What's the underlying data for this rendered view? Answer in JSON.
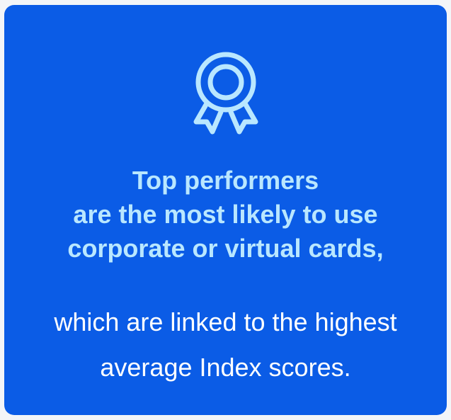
{
  "card": {
    "icon": "award-ribbon-icon",
    "headline": {
      "line1": "Top performers",
      "line2": "are the most likely to use",
      "line3": "corporate or virtual cards,"
    },
    "subtext": {
      "line1": "which are linked to the highest",
      "line2": "average Index scores."
    }
  },
  "colors": {
    "card_background": "#0b5ce6",
    "headline_text": "#b9e7ff",
    "subtext_text": "#ffffff",
    "icon_stroke": "#b9e7ff"
  }
}
